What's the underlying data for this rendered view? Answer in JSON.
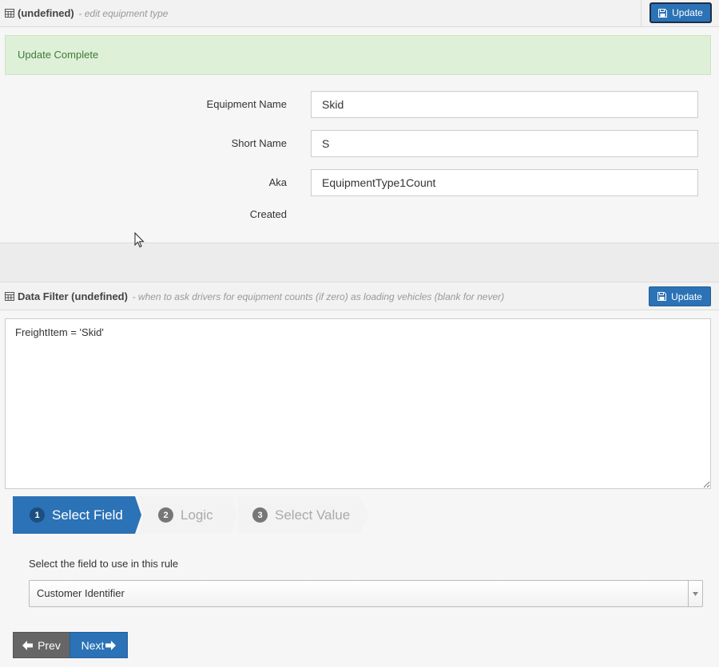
{
  "header": {
    "title": "(undefined)",
    "subtitle": "- edit equipment type",
    "update_label": "Update"
  },
  "alert": {
    "message": "Update Complete"
  },
  "form": {
    "equipment_name": {
      "label": "Equipment Name",
      "value": "Skid"
    },
    "short_name": {
      "label": "Short Name",
      "value": "S"
    },
    "aka": {
      "label": "Aka",
      "value": "EquipmentType1Count"
    },
    "created": {
      "label": "Created",
      "value": ""
    }
  },
  "data_filter": {
    "title": "Data Filter (undefined)",
    "subtitle": "- when to ask drivers for equipment counts (if zero) as loading vehicles (blank for never)",
    "update_label": "Update",
    "expression": "FreightItem = 'Skid'"
  },
  "wizard": {
    "steps": [
      {
        "number": "1",
        "label": "Select Field",
        "active": true
      },
      {
        "number": "2",
        "label": "Logic",
        "active": false
      },
      {
        "number": "3",
        "label": "Select Value",
        "active": false
      }
    ],
    "field_prompt": "Select the field to use in this rule",
    "selected_field": "Customer Identifier",
    "prev_label": "Prev",
    "next_label": "Next"
  },
  "colors": {
    "primary": "#2b72b6",
    "success_bg": "#def0d8",
    "success_text": "#3f7a36",
    "prev_button": "#666666"
  },
  "icons": {
    "header": "table-icon",
    "update": "save-icon",
    "prev": "arrow-left-icon",
    "next": "arrow-right-icon",
    "select": "caret-down-icon"
  }
}
